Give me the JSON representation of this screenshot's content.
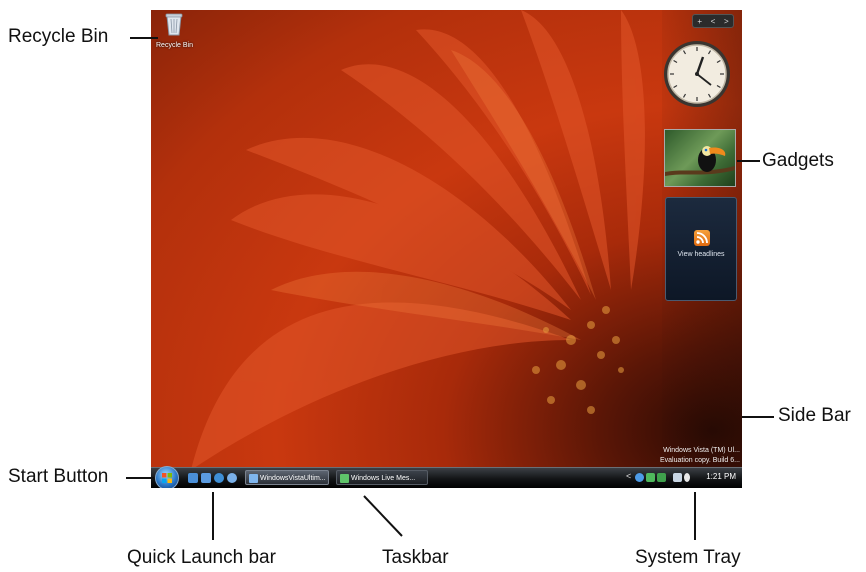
{
  "callouts": {
    "recycle_bin": "Recycle Bin",
    "gadgets": "Gadgets",
    "side_bar": "Side Bar",
    "start_button": "Start Button",
    "quick_launch": "Quick Launch bar",
    "taskbar": "Taskbar",
    "system_tray": "System Tray"
  },
  "desktop": {
    "recycle_bin_label": "Recycle Bin",
    "watermark_line1": "Windows Vista (TM) Ul...",
    "watermark_line2": "Evaluation copy. Build 6..."
  },
  "sidebar": {
    "controls": [
      "+",
      "<",
      ">"
    ],
    "feeds_label": "View headlines"
  },
  "taskbar": {
    "tasks": [
      "WindowsVistaUltim...",
      "Windows Live Mes..."
    ],
    "time": "1:21 PM",
    "tray_arrow": "<"
  },
  "colors": {
    "wallpaper": "#c9380f",
    "taskbar": "#121416",
    "start_orb": "#2a78c8",
    "rss": "#f08020"
  }
}
